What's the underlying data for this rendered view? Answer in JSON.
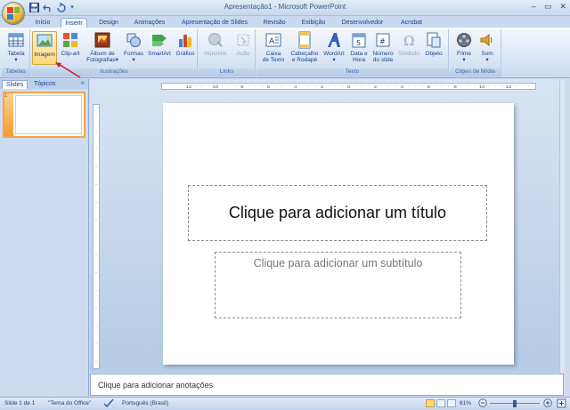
{
  "window": {
    "title": "Apresentação1 - Microsoft PowerPoint",
    "controls": [
      "–",
      "▭",
      "✕"
    ]
  },
  "qat": {
    "icons": [
      "save-icon",
      "undo-icon",
      "redo-icon"
    ]
  },
  "tabs": [
    {
      "label": "Início"
    },
    {
      "label": "Inserir"
    },
    {
      "label": "Design"
    },
    {
      "label": "Animações"
    },
    {
      "label": "Apresentação de Slides"
    },
    {
      "label": "Revisão"
    },
    {
      "label": "Exibição"
    },
    {
      "label": "Desenvolvedor"
    },
    {
      "label": "Acrobat"
    }
  ],
  "active_tab": "Inserir",
  "ribbon": {
    "groups": {
      "tabelas": "Tabelas",
      "ilustracoes": "Ilustrações",
      "links": "Links",
      "texto": "Texto",
      "clipes": "Clipes de Mídia"
    },
    "buttons": {
      "tabela": "Tabela",
      "imagem": "Imagem",
      "clipart": "Clip-art",
      "album1": "Álbum de",
      "album2": "Fotografias",
      "formas": "Formas",
      "smartart": "SmartArt",
      "grafico": "Gráfico",
      "hyperlink": "Hiperlink",
      "acao": "Ação",
      "caixa1": "Caixa",
      "caixa2": "de Texto",
      "cab1": "Cabeçalho",
      "cab2": "e Rodapé",
      "wordart": "WordArt",
      "data1": "Data e",
      "data2": "Hora",
      "num1": "Número",
      "num2": "do slide",
      "simbolo": "Símbolo",
      "objeto": "Objeto",
      "filme": "Filme",
      "som": "Som"
    },
    "accent": "#ffd877"
  },
  "panel": {
    "tab_slides": "Slides",
    "tab_topicos": "Tópicos",
    "close": "×",
    "slide_number": "1"
  },
  "slide": {
    "title_placeholder": "Clique para adicionar um título",
    "subtitle_placeholder": "Clique para adicionar um subtítulo"
  },
  "notes": {
    "placeholder": "Clique para adicionar anotações"
  },
  "ruler": {
    "h_labels": [
      "12",
      "10",
      "8",
      "6",
      "4",
      "2",
      "0",
      "2",
      "4",
      "6",
      "8",
      "10",
      "12"
    ]
  },
  "status": {
    "slide": "Slide 1 de 1",
    "theme": "\"Tema do Office\"",
    "language": "Português (Brasil)",
    "zoom": "61%"
  }
}
